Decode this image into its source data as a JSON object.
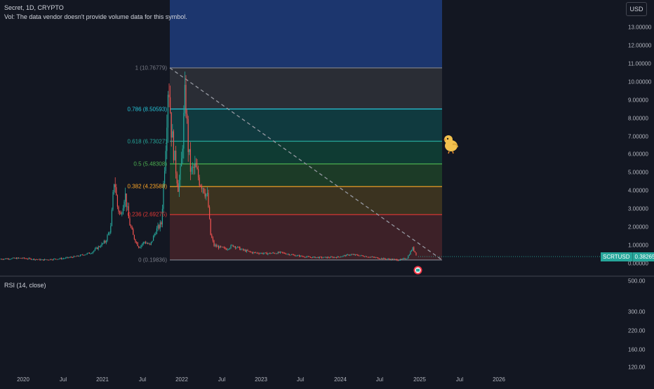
{
  "header": {
    "symbol_line": "Secret, 1D, CRYPTO",
    "volume_note": "Vol: The data vendor doesn't provide volume data for this symbol.",
    "currency_button": "USD"
  },
  "price_axis": {
    "labels": [
      "13.00000",
      "12.00000",
      "11.00000",
      "10.00000",
      "9.00000",
      "8.00000",
      "7.00000",
      "6.00000",
      "5.00000",
      "4.00000",
      "3.00000",
      "2.00000",
      "1.00000",
      "0.00000"
    ]
  },
  "last_price": {
    "symbol": "SCRTUSD",
    "value": "0.38265",
    "color": "#26a69a"
  },
  "time_axis": {
    "labels": [
      "2020",
      "Jul",
      "2021",
      "Jul",
      "2022",
      "Jul",
      "2023",
      "Jul",
      "2024",
      "Jul",
      "2025",
      "Jul",
      "2026"
    ]
  },
  "fib_levels": [
    {
      "label": "1 (10.76779)",
      "price": 10.76779,
      "color": "#787b86",
      "fill": "#2a2d35"
    },
    {
      "label": "0.786 (8.50593)",
      "price": 8.50593,
      "color": "#26c6da",
      "fill": "#103a3f"
    },
    {
      "label": "0.618 (6.73027)",
      "price": 6.73027,
      "color": "#26a69a",
      "fill": "#0f3b33"
    },
    {
      "label": "0.5 (5.48308)",
      "price": 5.48308,
      "color": "#4caf50",
      "fill": "#1c3b27"
    },
    {
      "label": "0.382 (4.23588)",
      "price": 4.23588,
      "color": "#ffa726",
      "fill": "#3b3320"
    },
    {
      "label": "0.236 (2.69275)",
      "price": 2.69275,
      "color": "#e53935",
      "fill": "#3d2128"
    },
    {
      "label": "0 (0.19836)",
      "price": 0.19836,
      "color": "#787b86",
      "fill": null
    }
  ],
  "fib_top_fill": "#1e3a77",
  "rsi": {
    "title": "RSI (14, close)",
    "labels": [
      "500.00",
      "300.00",
      "220.00",
      "160.00",
      "120.00"
    ]
  },
  "colors": {
    "up": "#26a69a",
    "down": "#ef5350",
    "background": "#131722"
  },
  "icons": {
    "chick": "chick-icon",
    "event": "event-flag-icon"
  }
}
